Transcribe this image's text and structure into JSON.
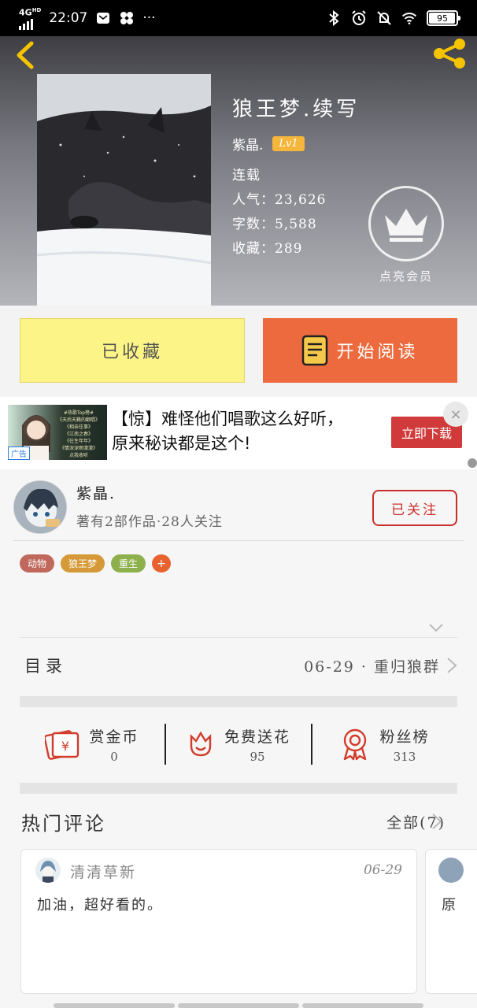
{
  "status_bar": {
    "network": "4G",
    "network_sub": "HD",
    "time": "22:07",
    "more": "···",
    "battery": "95"
  },
  "book": {
    "title": "狼王梦.续写",
    "author": "紫晶.",
    "level": "Lv1",
    "status": "连载",
    "popularity_label": "人气：",
    "popularity": "23,626",
    "words_label": "字数：",
    "words": "5,588",
    "favorites_label": "收藏：",
    "favorites": "289",
    "vip_label": "点亮会员"
  },
  "actions": {
    "collected_label": "已收藏",
    "read_label": "开始阅读"
  },
  "ad": {
    "line1": "【惊】难怪他们唱歌这么好听，",
    "line2": "原来秘诀都是这个!",
    "button": "立即下载",
    "tag": "广告",
    "close": "×",
    "image_text": [
      "#热歌Top榜#",
      "《天后天籁的翻唱》",
      "《相亲往事》",
      "《江南之春》",
      "《往生年年》",
      "《情深深雨濛濛》",
      "点我收听"
    ]
  },
  "author_section": {
    "name": "紫晶.",
    "info": "著有2部作品·28人关注",
    "follow_label": "已关注",
    "tags": [
      {
        "label": "动物",
        "color": "#c0685c"
      },
      {
        "label": "狼王梦",
        "color": "#d59a37"
      },
      {
        "label": "重生",
        "color": "#8db04c"
      },
      {
        "label": "+",
        "color": "#e7622e"
      }
    ]
  },
  "toc": {
    "label": "目录",
    "last_chapter": "06-29 · 重归狼群"
  },
  "stats": [
    {
      "label": "赏金币",
      "value": "0"
    },
    {
      "label": "免费送花",
      "value": "95"
    },
    {
      "label": "粉丝榜",
      "value": "313"
    }
  ],
  "comments": {
    "title": "热门评论",
    "all_label": "全部(7)",
    "items": [
      {
        "user": "清清草新",
        "date": "06-29",
        "content": "加油，超好看的。"
      },
      {
        "user": "",
        "date": "",
        "content": "原"
      }
    ]
  },
  "colors": {
    "accent_orange": "#ec6a3d",
    "collect_yellow": "#fcf486",
    "follow_red": "#c9302c",
    "level_badge": "#f4b63b"
  }
}
